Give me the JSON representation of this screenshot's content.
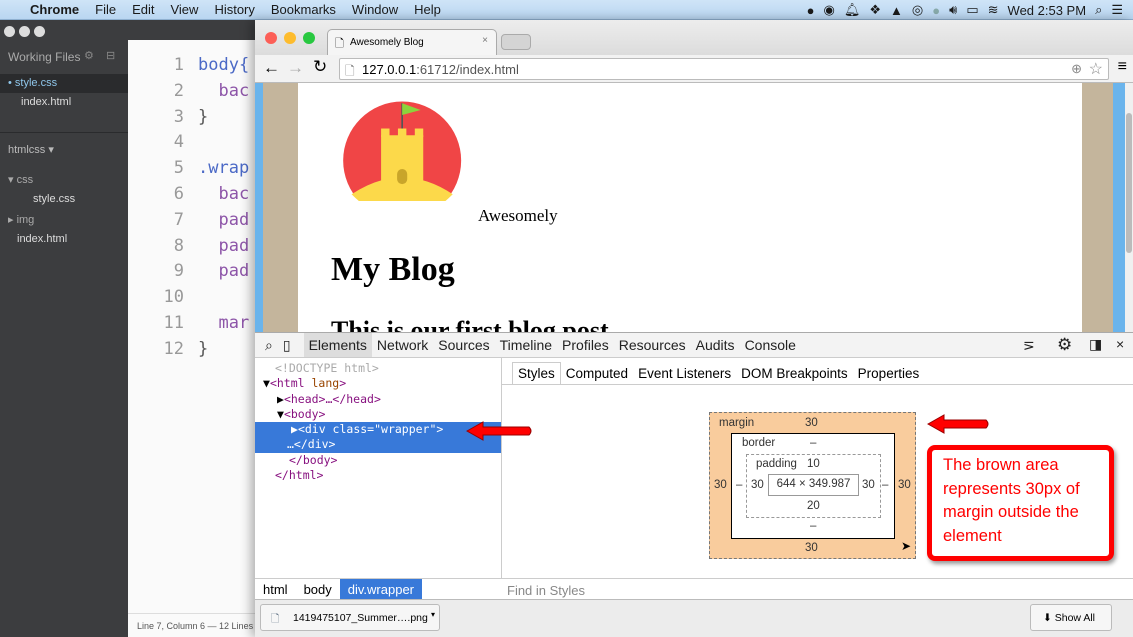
{
  "menubar": {
    "app": "Chrome",
    "items": [
      "File",
      "Edit",
      "View",
      "History",
      "Bookmarks",
      "Window",
      "Help"
    ],
    "clock": "Wed 2:53 PM"
  },
  "brackets": {
    "working_files": "Working Files",
    "open_files": [
      "style.css",
      "index.html"
    ],
    "project": "htmlcss ▾",
    "tree": {
      "css": "css",
      "css_style": "style.css",
      "img": "img",
      "index": "index.html"
    },
    "lines": [
      "1",
      "2",
      "3",
      "4",
      "5",
      "6",
      "7",
      "8",
      "9",
      "10",
      "11",
      "12"
    ],
    "code": [
      "body{",
      "  bac",
      "}",
      "",
      ".wrap",
      "  bac",
      "  pad",
      "  pad",
      "  pad",
      "",
      "  mar",
      "}"
    ],
    "status": "Line 7, Column 6 — 12 Lines"
  },
  "chrome": {
    "tab_title": "Awesomely Blog",
    "url_host": "127.0.0.1",
    "url_rest": ":61712/index.html",
    "page": {
      "logo_text": "Awesomely",
      "heading": "My Blog",
      "post_title": "This is our first blog post"
    },
    "devtools": {
      "tabs": [
        "Elements",
        "Network",
        "Sources",
        "Timeline",
        "Profiles",
        "Resources",
        "Audits",
        "Console"
      ],
      "dom": {
        "doctype": "<!DOCTYPE html>",
        "html": "<html",
        "lang": "lang",
        "head": "<head>…</head>",
        "body": "<body>",
        "div_open": "<div class=\"wrapper\">",
        "div_close": "…</div>",
        "body_close": "</body>",
        "html_close": "</html>"
      },
      "breadcrumbs": [
        "html",
        "body",
        "div.wrapper"
      ],
      "style_tabs": [
        "Styles",
        "Computed",
        "Event Listeners",
        "DOM Breakpoints",
        "Properties"
      ],
      "box_model": {
        "margin_label": "margin",
        "margin": {
          "top": "30",
          "right": "30",
          "bottom": "30",
          "left": "30"
        },
        "border_label": "border",
        "border": {
          "top": "–",
          "right": "–",
          "bottom": "–",
          "left": "–"
        },
        "padding_label": "padding",
        "padding": {
          "top": "10",
          "right": "30",
          "bottom": "20",
          "left": "30"
        },
        "content": "644 × 349.987"
      },
      "find_placeholder": "Find in Styles"
    },
    "download": {
      "file": "1419475107_Summer….png",
      "show_all": "Show All"
    }
  },
  "annotation": {
    "text": "The brown area represents 30px of margin outside the element",
    "color": "#ff0000"
  },
  "colors": {
    "margin": "#f9cc9d",
    "selection": "#3879d9",
    "page_tan": "#c4b59c",
    "page_blue": "#6ab4ec",
    "logo_red": "#f04546",
    "logo_yellow": "#fcd94a"
  }
}
